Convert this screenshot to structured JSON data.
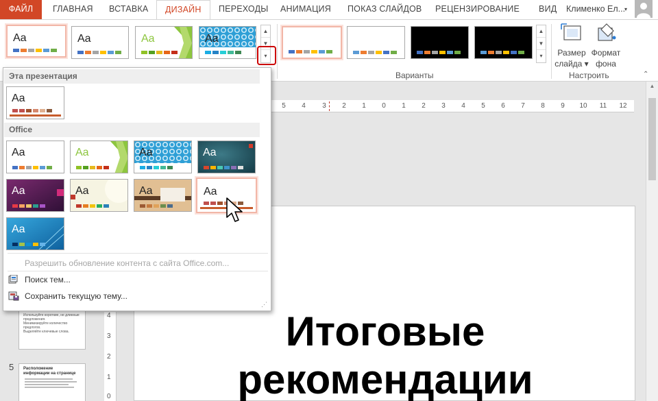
{
  "tabs": {
    "file": "ФАЙЛ",
    "home": "ГЛАВНАЯ",
    "insert": "ВСТАВКА",
    "design": "ДИЗАЙН",
    "transitions": "ПЕРЕХОДЫ",
    "animation": "АНИМАЦИЯ",
    "slideshow": "ПОКАЗ СЛАЙДОВ",
    "review": "РЕЦЕНЗИРОВАНИЕ",
    "view": "ВИД"
  },
  "user": {
    "name": "Клименко Ел...",
    "caret": "▾"
  },
  "ribbon": {
    "theme_sample_text": "Aa",
    "variants_label": "Варианты",
    "customize_label": "Настроить",
    "slide_size_line1": "Размер",
    "slide_size_line2": "слайда ▾",
    "format_bg_line1": "Формат",
    "format_bg_line2": "фона",
    "collapse": "⌃"
  },
  "dropdown": {
    "section_this": "Эта презентация",
    "section_office": "Office",
    "theme_sample_text": "Aa",
    "cmd_update": "Разрешить обновление контента с сайта Office.com...",
    "cmd_browse": "Поиск тем...",
    "cmd_save": "Сохранить текущую тему..."
  },
  "ruler": [
    "5",
    "4",
    "3",
    "2",
    "1",
    "2",
    "1",
    "0",
    "1",
    "2",
    "3",
    "4",
    "5",
    "6",
    "7",
    "8",
    "9",
    "10",
    "11",
    "12"
  ],
  "ruler_v": [
    "4",
    "3",
    "2",
    "1",
    "0"
  ],
  "slide_panel": {
    "slide4_lines": [
      "Используйте короткие, не длинные предложения.",
      "Минимизируйте количество предлогов.",
      "Выделяйте ключевые слова."
    ],
    "slide5_number": "5",
    "slide5_title_line1": "Расположение",
    "slide5_title_line2": "информации на странице"
  },
  "slide": {
    "title_line1": "Итоговые",
    "title_line2": "рекомендации"
  },
  "colors": {
    "accent": "#d24726",
    "selection_border": "#f2b6a7",
    "highlight_box": "#cc0000"
  }
}
